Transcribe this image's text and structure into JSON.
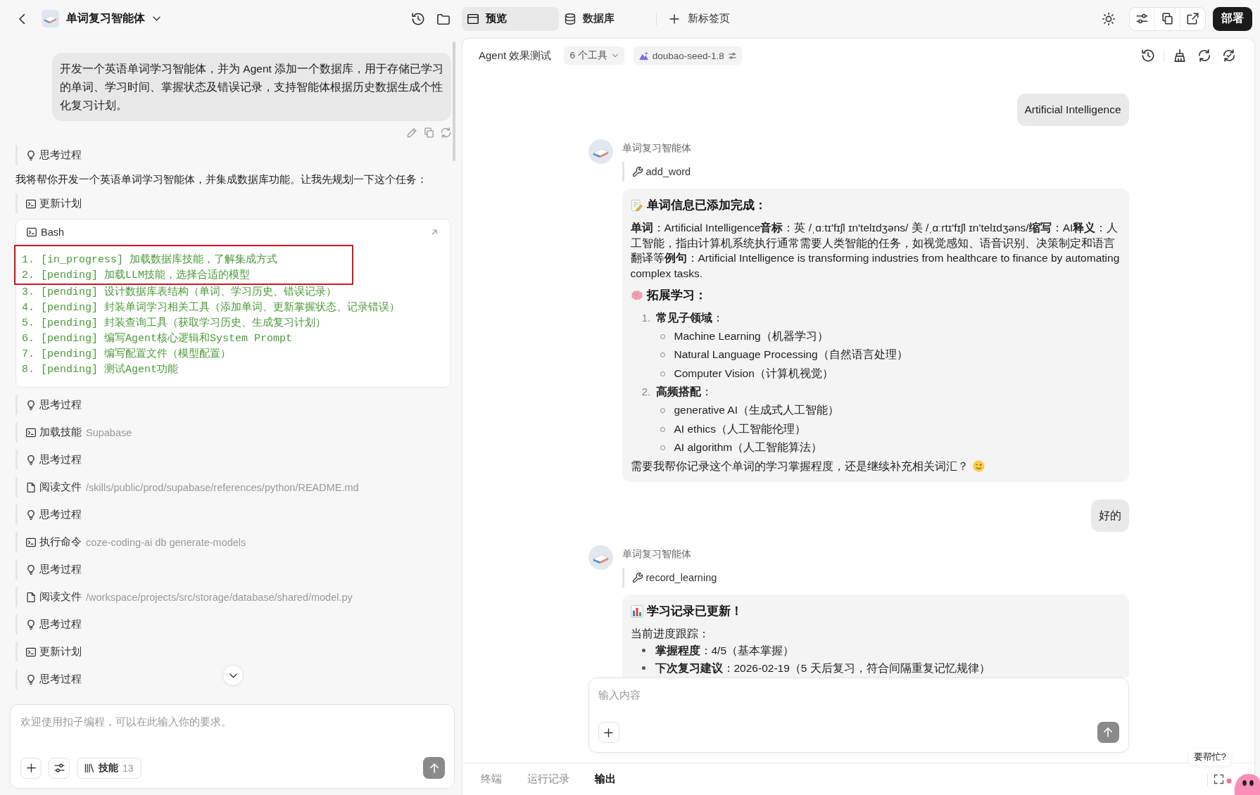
{
  "top_bar": {
    "title": "单词复习智能体",
    "tabs": [
      {
        "kind": "preview",
        "label": "预览",
        "selected": true
      },
      {
        "kind": "database",
        "label": "数据库",
        "selected": false
      }
    ],
    "new_tab": "新标签页",
    "deploy": "部署"
  },
  "left_panel": {
    "user_message": "开发一个英语单词学习智能体，并为 Agent 添加一个数据库，用于存储已学习的单词、学习时间、掌握状态及错误记录，支持智能体根据历史数据生成个性化复习计划。",
    "timeline": [
      {
        "kind": "thought",
        "label": "思考过程"
      },
      {
        "kind": "text",
        "text": "我将帮你开发一个英语单词学习智能体，并集成数据库功能。让我先规划一下这个任务："
      },
      {
        "kind": "command",
        "label": "更新计划"
      },
      {
        "kind": "bash",
        "title": "Bash",
        "lines": [
          {
            "text": "1. [in_progress] 加载数据库技能，了解集成方式",
            "highlighted": true
          },
          {
            "text": "2. [pending] 加载LLM技能，选择合适的模型",
            "highlighted": true
          },
          {
            "text": "3. [pending] 设计数据库表结构（单词、学习历史、错误记录）",
            "highlighted": false
          },
          {
            "text": "4. [pending] 封装单词学习相关工具（添加单词、更新掌握状态、记录错误）",
            "highlighted": false
          },
          {
            "text": "5. [pending] 封装查询工具（获取学习历史、生成复习计划）",
            "highlighted": false
          },
          {
            "text": "6. [pending] 编写Agent核心逻辑和System Prompt",
            "highlighted": false
          },
          {
            "text": "7. [pending] 编写配置文件（模型配置）",
            "highlighted": false
          },
          {
            "text": "8. [pending] 测试Agent功能",
            "highlighted": false
          }
        ]
      },
      {
        "kind": "thought",
        "label": "思考过程"
      },
      {
        "kind": "command",
        "label": "加载技能",
        "detail": "Supabase"
      },
      {
        "kind": "thought",
        "label": "思考过程"
      },
      {
        "kind": "file",
        "label": "阅读文件",
        "detail": "/skills/public/prod/supabase/references/python/README.md"
      },
      {
        "kind": "thought",
        "label": "思考过程"
      },
      {
        "kind": "command",
        "label": "执行命令",
        "detail": "coze-coding-ai db generate-models"
      },
      {
        "kind": "thought",
        "label": "思考过程"
      },
      {
        "kind": "file",
        "label": "阅读文件",
        "detail": "/workspace/projects/src/storage/database/shared/model.py"
      },
      {
        "kind": "thought",
        "label": "思考过程"
      },
      {
        "kind": "command",
        "label": "更新计划"
      },
      {
        "kind": "thought",
        "label": "思考过程"
      }
    ],
    "composer": {
      "placeholder": "欢迎使用扣子编程，可以在此输入你的要求。",
      "skills_label": "技能",
      "skills_count": "13"
    }
  },
  "preview": {
    "title": "Agent 效果测试",
    "tools": "6 个工具",
    "model": "doubao-seed-1.8",
    "messages": [
      {
        "kind": "user",
        "text": "Artificial Intelligence"
      },
      {
        "kind": "agent",
        "name": "单词复习智能体",
        "tool": "add_word",
        "blocks": [
          {
            "kind": "heading",
            "text": "单词信息已添加完成："
          },
          {
            "kind": "para",
            "text": "**单词**：Artificial Intelligence**音标**：英 /ˌɑːtɪ'fɪʃl ɪn'telɪdʒəns/ 美 /ˌɑːrtɪ'fɪʃl ɪn'telɪdʒəns/**缩写**：AI**释义**：人工智能，指由计算机系统执行通常需要人类智能的任务，如视觉感知、语音识别、决策制定和语言翻译等**例句**：Artificial Intelligence is transforming industries from healthcare to finance by automating complex tasks."
          },
          {
            "kind": "heading",
            "text": "拓展学习："
          },
          {
            "kind": "numbered",
            "items": [
              {
                "number": "1.",
                "label": "**常见子领域**：",
                "children": [
                  "Machine Learning（机器学习）",
                  "Natural Language Processing（自然语言处理）",
                  "Computer Vision（计算机视觉）"
                ]
              },
              {
                "number": "2.",
                "label": "**高频搭配**：",
                "children": [
                  "generative AI（生成式人工智能）",
                  "AI ethics（人工智能伦理）",
                  "AI algorithm（人工智能算法）"
                ]
              }
            ]
          },
          {
            "kind": "closing",
            "text": "需要我帮你记录这个单词的学习掌握程度，还是继续补充相关词汇？"
          }
        ]
      },
      {
        "kind": "user",
        "text": "好的"
      },
      {
        "kind": "agent",
        "name": "单词复习智能体",
        "tool": "record_learning",
        "blocks": [
          {
            "kind": "heading",
            "text": "学习记录已更新！"
          },
          {
            "kind": "para",
            "text": "当前进度跟踪："
          },
          {
            "kind": "bullets",
            "items": [
              "**掌握程度**：4/5（基本掌握）",
              "**下次复习建议**：2026-02-19（5 天后复习，符合间隔重复记忆规律）"
            ]
          }
        ]
      }
    ],
    "composer": {
      "placeholder": "输入内容"
    }
  },
  "bottom_tabs": [
    {
      "label": "终端",
      "selected": false
    },
    {
      "label": "运行记录",
      "selected": false
    },
    {
      "label": "输出",
      "selected": true
    }
  ],
  "help_tip": "要帮忙?"
}
